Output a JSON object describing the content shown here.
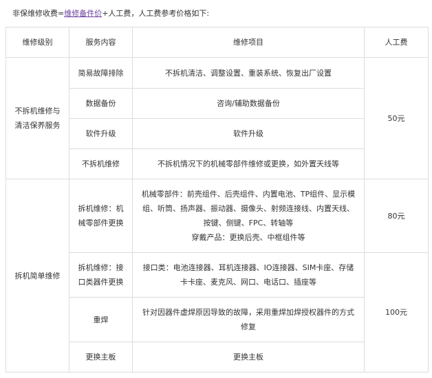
{
  "intro": {
    "prefix": "非保维修收费=",
    "link": "维修备件价",
    "suffix": "+人工费，人工费参考价格如下:"
  },
  "table": {
    "headers": [
      "维修级别",
      "服务内容",
      "维修项目",
      "人工费"
    ],
    "groups": [
      {
        "level": "不拆机维修与清洁保养服务",
        "fee": "50元",
        "rows": [
          {
            "service": "简易故障排除",
            "items": "不拆机清洁、调整设置、重装系统、恢复出厂设置"
          },
          {
            "service": "数据备份",
            "items": "咨询/辅助数据备份"
          },
          {
            "service": "软件升级",
            "items": "软件升级"
          },
          {
            "service": "不拆机维修",
            "items": "不拆机情况下的机械零部件维修或更换，如外置天线等"
          }
        ]
      },
      {
        "level": "拆机简单维修",
        "fee_80": "80元",
        "fee_100": "100元",
        "rows": [
          {
            "service": "拆机维修：机械零部件更换",
            "items": "机械零部件：前壳组件、后壳组件、内置电池、TP组件、显示模组、听筒、扬声器、振动器、摄像头、射频连接线、内置天线、按键、侧键、FPC、转轴等",
            "items2": "穿戴产品：更换后壳、中框组件等"
          },
          {
            "service": "拆机维修：接口类器件更换",
            "items": "接口类：电池连接器、耳机连接器、IO连接器、SIM卡座、存储卡卡座、麦克风、网口、电话口、插座等"
          },
          {
            "service": "重焊",
            "items": "针对因器件虚焊原因导致的故障，采用重焊加焊授权器件的方式修复"
          },
          {
            "service": "更换主板",
            "items": "更换主板"
          }
        ]
      }
    ]
  }
}
